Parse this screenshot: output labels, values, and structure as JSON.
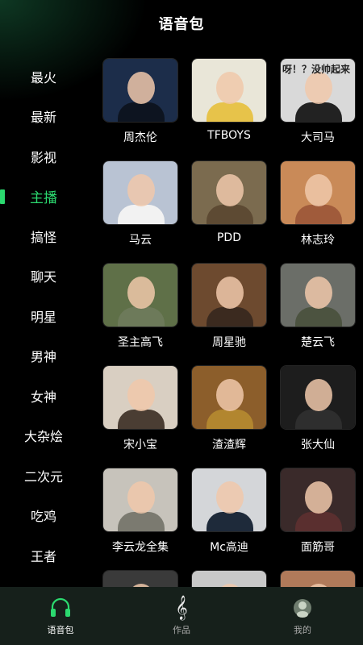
{
  "header": {
    "title": "语音包"
  },
  "sidebar": {
    "active_index": 3,
    "items": [
      {
        "label": "最火"
      },
      {
        "label": "最新"
      },
      {
        "label": "影视"
      },
      {
        "label": "主播"
      },
      {
        "label": "搞怪"
      },
      {
        "label": "聊天"
      },
      {
        "label": "明星"
      },
      {
        "label": "男神"
      },
      {
        "label": "女神"
      },
      {
        "label": "大杂烩"
      },
      {
        "label": "二次元"
      },
      {
        "label": "吃鸡"
      },
      {
        "label": "王者"
      }
    ]
  },
  "grid": {
    "items": [
      {
        "name": "周杰伦",
        "color": "#1c2d4a",
        "body": "#0d1420"
      },
      {
        "name": "TFBOYS",
        "color": "#e9e6d8",
        "body": "#e7c34a"
      },
      {
        "name": "大司马",
        "color": "#d9d9d9",
        "body": "#222",
        "overlay": "呀！？没帅起来"
      },
      {
        "name": "马云",
        "color": "#b9c3d3",
        "body": "#f2f2f2"
      },
      {
        "name": "PDD",
        "color": "#7b6b4f",
        "body": "#5d4a33"
      },
      {
        "name": "林志玲",
        "color": "#c98a58",
        "body": "#a05b3b"
      },
      {
        "name": "圣主高飞",
        "color": "#5f7048",
        "body": "#6d7a5a"
      },
      {
        "name": "周星驰",
        "color": "#6d4a2f",
        "body": "#3b2a1f"
      },
      {
        "name": "楚云飞",
        "color": "#6b6e68",
        "body": "#4c5340"
      },
      {
        "name": "宋小宝",
        "color": "#d9cfc2",
        "body": "#4a3d33"
      },
      {
        "name": "渣渣辉",
        "color": "#8c5e2b",
        "body": "#b2862f"
      },
      {
        "name": "张大仙",
        "color": "#1d1d1d",
        "body": "#2e2e2e"
      },
      {
        "name": "李云龙全集",
        "color": "#c7c3bb",
        "body": "#7b7a70"
      },
      {
        "name": "Mc高迪",
        "color": "#d4d6d9",
        "body": "#1e2a3a"
      },
      {
        "name": "面筋哥",
        "color": "#3a2a2a",
        "body": "#5a2f2f"
      },
      {
        "name": "",
        "color": "#3a3a3a",
        "body": "#2a2a2a"
      },
      {
        "name": "",
        "color": "#c8c8c8",
        "body": "#9a9a9a"
      },
      {
        "name": "",
        "color": "#b07a5a",
        "body": "#8a5a40"
      }
    ]
  },
  "tabbar": {
    "tabs": [
      {
        "label": "语音包",
        "icon": "headphones-icon",
        "active": true
      },
      {
        "label": "作品",
        "icon": "treble-clef-icon",
        "active": false
      },
      {
        "label": "我的",
        "icon": "profile-avatar-icon",
        "active": false
      }
    ],
    "accent": "#2bd96f"
  }
}
